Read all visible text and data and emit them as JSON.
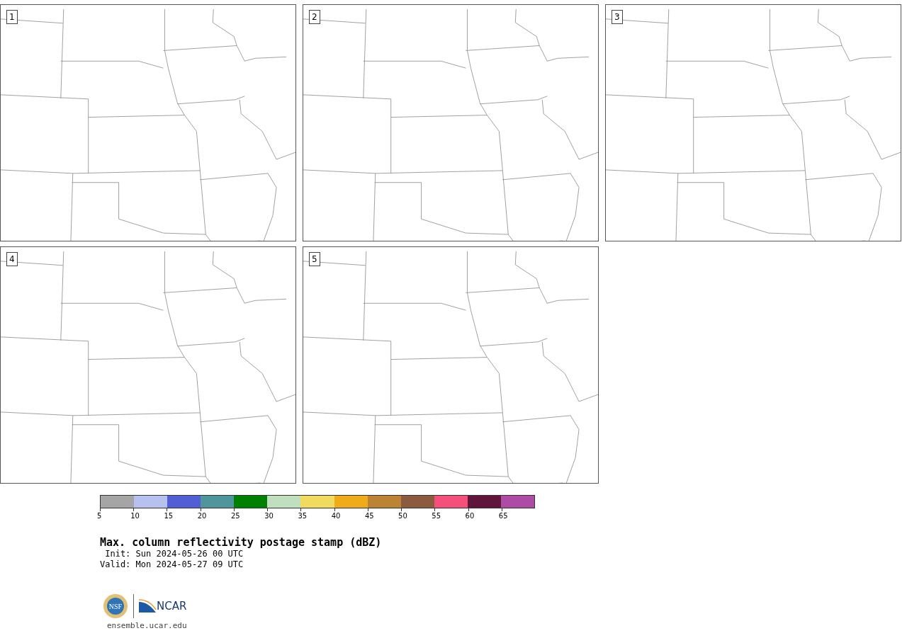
{
  "panels": [
    {
      "label": "1"
    },
    {
      "label": "2"
    },
    {
      "label": "3"
    },
    {
      "label": "4"
    },
    {
      "label": "5"
    }
  ],
  "colorbar": {
    "segments": [
      {
        "color": "#a5a5a5"
      },
      {
        "color": "#b7c1ee"
      },
      {
        "color": "#525ed6"
      },
      {
        "color": "#4f969c"
      },
      {
        "color": "#008000"
      },
      {
        "color": "#bfdfbf"
      },
      {
        "color": "#f0db5e"
      },
      {
        "color": "#f0ab19"
      },
      {
        "color": "#bb8333"
      },
      {
        "color": "#8b5a3f"
      },
      {
        "color": "#f54f7c"
      },
      {
        "color": "#60163a"
      },
      {
        "color": "#ad4ba5"
      }
    ],
    "ticks": [
      "5",
      "10",
      "15",
      "20",
      "25",
      "30",
      "35",
      "40",
      "45",
      "50",
      "55",
      "60",
      "65"
    ]
  },
  "title": "Max. column reflectivity postage stamp (dBZ)",
  "init": " Init: Sun 2024-05-26 00 UTC",
  "valid": "Valid: Mon 2024-05-27 09 UTC",
  "logos": {
    "nsf": "NSF",
    "ncar": "NCAR"
  },
  "url": "ensemble.ucar.edu"
}
